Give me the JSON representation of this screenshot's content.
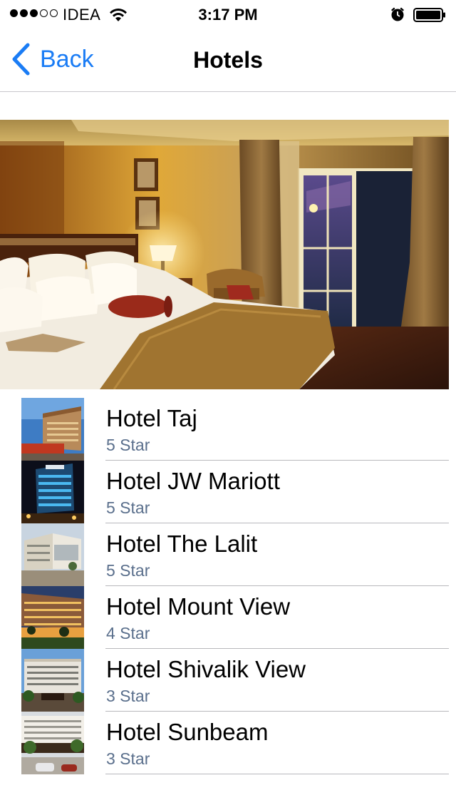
{
  "status_bar": {
    "carrier": "IDEA",
    "time": "3:17 PM",
    "signal_bars_filled": 3,
    "signal_bars_total": 5
  },
  "nav": {
    "back_label": "Back",
    "title": "Hotels"
  },
  "colors": {
    "accent": "#1a7cf5",
    "subtitle": "#5a6f8c",
    "separator": "#b8b8bc"
  },
  "hotels": [
    {
      "name": "Hotel Taj",
      "rating": "5 Star"
    },
    {
      "name": "Hotel JW Mariott",
      "rating": "5 Star"
    },
    {
      "name": "Hotel The Lalit",
      "rating": "5 Star"
    },
    {
      "name": "Hotel Mount View",
      "rating": "4 Star"
    },
    {
      "name": "Hotel Shivalik View",
      "rating": "3 Star"
    },
    {
      "name": "Hotel Sunbeam",
      "rating": "3 Star"
    }
  ]
}
